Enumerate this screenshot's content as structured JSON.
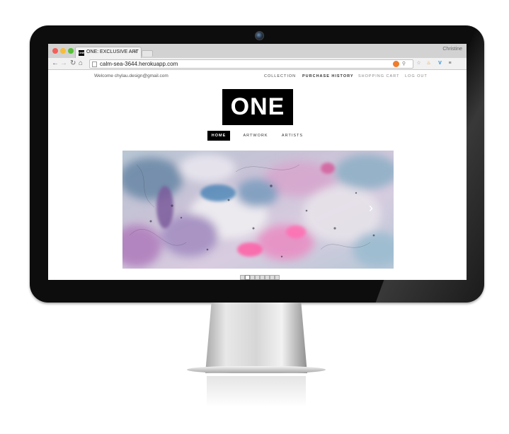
{
  "browser": {
    "tab_title": "ONE: EXCLUSIVE ART",
    "tab_favicon": "ONE",
    "tab_close": "×",
    "profile_name": "Christine",
    "url": "calm-sea-3644.herokuapp.com",
    "icons": [
      "back-icon",
      "forward-icon",
      "reload-icon",
      "home-icon",
      "page-icon",
      "extension-icon",
      "search-icon",
      "star-icon",
      "fire-icon",
      "v-extension-icon",
      "menu-icon"
    ],
    "traffic_light_colors": [
      "#f25f58",
      "#f6bc3a",
      "#57c038"
    ]
  },
  "site": {
    "welcome_text": "Welcome chylau.design@gmail.com",
    "top_nav": [
      "COLLECTION",
      "PURCHASE HISTORY",
      "SHOPPING CART",
      "LOG OUT"
    ],
    "logo_text": "ONE",
    "menu": [
      "HOME",
      "ARTWORK",
      "ARTISTS"
    ],
    "active_menu": "HOME",
    "slider": {
      "next_arrow": "›",
      "slide_count": 8,
      "active_slide": 1
    },
    "colors": {
      "logo_bg": "#000000",
      "active_menu_bg": "#000000"
    }
  }
}
